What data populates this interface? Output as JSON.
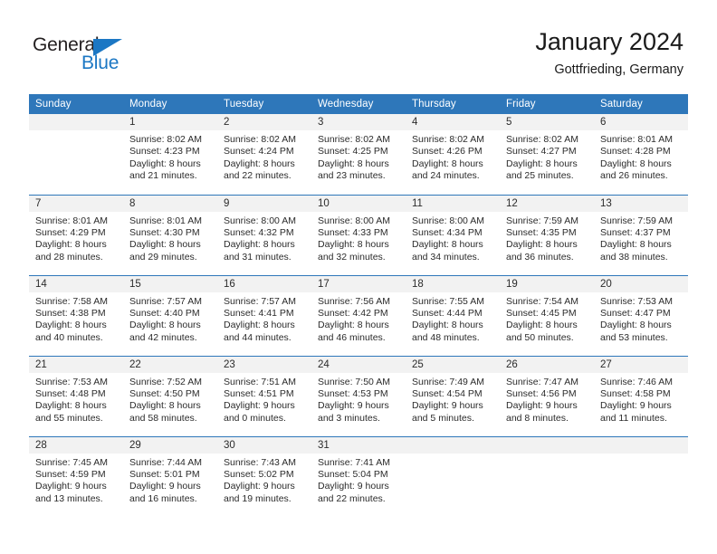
{
  "brand": {
    "name_top": "General",
    "name_bottom": "Blue",
    "accent_color": "#1b77c4"
  },
  "header": {
    "title": "January 2024",
    "location": "Gottfrieding, Germany",
    "header_bg_color": "#2e77ba",
    "daynum_bg_color": "#f2f2f2"
  },
  "weekday_headers": [
    "Sunday",
    "Monday",
    "Tuesday",
    "Wednesday",
    "Thursday",
    "Friday",
    "Saturday"
  ],
  "labels": {
    "sunrise": "Sunrise:",
    "sunset": "Sunset:",
    "daylight": "Daylight:"
  },
  "weeks": [
    [
      {
        "day": "",
        "blank": true
      },
      {
        "day": "1",
        "sunrise": "Sunrise: 8:02 AM",
        "sunset": "Sunset: 4:23 PM",
        "daylight1": "Daylight: 8 hours",
        "daylight2": "and 21 minutes."
      },
      {
        "day": "2",
        "sunrise": "Sunrise: 8:02 AM",
        "sunset": "Sunset: 4:24 PM",
        "daylight1": "Daylight: 8 hours",
        "daylight2": "and 22 minutes."
      },
      {
        "day": "3",
        "sunrise": "Sunrise: 8:02 AM",
        "sunset": "Sunset: 4:25 PM",
        "daylight1": "Daylight: 8 hours",
        "daylight2": "and 23 minutes."
      },
      {
        "day": "4",
        "sunrise": "Sunrise: 8:02 AM",
        "sunset": "Sunset: 4:26 PM",
        "daylight1": "Daylight: 8 hours",
        "daylight2": "and 24 minutes."
      },
      {
        "day": "5",
        "sunrise": "Sunrise: 8:02 AM",
        "sunset": "Sunset: 4:27 PM",
        "daylight1": "Daylight: 8 hours",
        "daylight2": "and 25 minutes."
      },
      {
        "day": "6",
        "sunrise": "Sunrise: 8:01 AM",
        "sunset": "Sunset: 4:28 PM",
        "daylight1": "Daylight: 8 hours",
        "daylight2": "and 26 minutes."
      }
    ],
    [
      {
        "day": "7",
        "sunrise": "Sunrise: 8:01 AM",
        "sunset": "Sunset: 4:29 PM",
        "daylight1": "Daylight: 8 hours",
        "daylight2": "and 28 minutes."
      },
      {
        "day": "8",
        "sunrise": "Sunrise: 8:01 AM",
        "sunset": "Sunset: 4:30 PM",
        "daylight1": "Daylight: 8 hours",
        "daylight2": "and 29 minutes."
      },
      {
        "day": "9",
        "sunrise": "Sunrise: 8:00 AM",
        "sunset": "Sunset: 4:32 PM",
        "daylight1": "Daylight: 8 hours",
        "daylight2": "and 31 minutes."
      },
      {
        "day": "10",
        "sunrise": "Sunrise: 8:00 AM",
        "sunset": "Sunset: 4:33 PM",
        "daylight1": "Daylight: 8 hours",
        "daylight2": "and 32 minutes."
      },
      {
        "day": "11",
        "sunrise": "Sunrise: 8:00 AM",
        "sunset": "Sunset: 4:34 PM",
        "daylight1": "Daylight: 8 hours",
        "daylight2": "and 34 minutes."
      },
      {
        "day": "12",
        "sunrise": "Sunrise: 7:59 AM",
        "sunset": "Sunset: 4:35 PM",
        "daylight1": "Daylight: 8 hours",
        "daylight2": "and 36 minutes."
      },
      {
        "day": "13",
        "sunrise": "Sunrise: 7:59 AM",
        "sunset": "Sunset: 4:37 PM",
        "daylight1": "Daylight: 8 hours",
        "daylight2": "and 38 minutes."
      }
    ],
    [
      {
        "day": "14",
        "sunrise": "Sunrise: 7:58 AM",
        "sunset": "Sunset: 4:38 PM",
        "daylight1": "Daylight: 8 hours",
        "daylight2": "and 40 minutes."
      },
      {
        "day": "15",
        "sunrise": "Sunrise: 7:57 AM",
        "sunset": "Sunset: 4:40 PM",
        "daylight1": "Daylight: 8 hours",
        "daylight2": "and 42 minutes."
      },
      {
        "day": "16",
        "sunrise": "Sunrise: 7:57 AM",
        "sunset": "Sunset: 4:41 PM",
        "daylight1": "Daylight: 8 hours",
        "daylight2": "and 44 minutes."
      },
      {
        "day": "17",
        "sunrise": "Sunrise: 7:56 AM",
        "sunset": "Sunset: 4:42 PM",
        "daylight1": "Daylight: 8 hours",
        "daylight2": "and 46 minutes."
      },
      {
        "day": "18",
        "sunrise": "Sunrise: 7:55 AM",
        "sunset": "Sunset: 4:44 PM",
        "daylight1": "Daylight: 8 hours",
        "daylight2": "and 48 minutes."
      },
      {
        "day": "19",
        "sunrise": "Sunrise: 7:54 AM",
        "sunset": "Sunset: 4:45 PM",
        "daylight1": "Daylight: 8 hours",
        "daylight2": "and 50 minutes."
      },
      {
        "day": "20",
        "sunrise": "Sunrise: 7:53 AM",
        "sunset": "Sunset: 4:47 PM",
        "daylight1": "Daylight: 8 hours",
        "daylight2": "and 53 minutes."
      }
    ],
    [
      {
        "day": "21",
        "sunrise": "Sunrise: 7:53 AM",
        "sunset": "Sunset: 4:48 PM",
        "daylight1": "Daylight: 8 hours",
        "daylight2": "and 55 minutes."
      },
      {
        "day": "22",
        "sunrise": "Sunrise: 7:52 AM",
        "sunset": "Sunset: 4:50 PM",
        "daylight1": "Daylight: 8 hours",
        "daylight2": "and 58 minutes."
      },
      {
        "day": "23",
        "sunrise": "Sunrise: 7:51 AM",
        "sunset": "Sunset: 4:51 PM",
        "daylight1": "Daylight: 9 hours",
        "daylight2": "and 0 minutes."
      },
      {
        "day": "24",
        "sunrise": "Sunrise: 7:50 AM",
        "sunset": "Sunset: 4:53 PM",
        "daylight1": "Daylight: 9 hours",
        "daylight2": "and 3 minutes."
      },
      {
        "day": "25",
        "sunrise": "Sunrise: 7:49 AM",
        "sunset": "Sunset: 4:54 PM",
        "daylight1": "Daylight: 9 hours",
        "daylight2": "and 5 minutes."
      },
      {
        "day": "26",
        "sunrise": "Sunrise: 7:47 AM",
        "sunset": "Sunset: 4:56 PM",
        "daylight1": "Daylight: 9 hours",
        "daylight2": "and 8 minutes."
      },
      {
        "day": "27",
        "sunrise": "Sunrise: 7:46 AM",
        "sunset": "Sunset: 4:58 PM",
        "daylight1": "Daylight: 9 hours",
        "daylight2": "and 11 minutes."
      }
    ],
    [
      {
        "day": "28",
        "sunrise": "Sunrise: 7:45 AM",
        "sunset": "Sunset: 4:59 PM",
        "daylight1": "Daylight: 9 hours",
        "daylight2": "and 13 minutes."
      },
      {
        "day": "29",
        "sunrise": "Sunrise: 7:44 AM",
        "sunset": "Sunset: 5:01 PM",
        "daylight1": "Daylight: 9 hours",
        "daylight2": "and 16 minutes."
      },
      {
        "day": "30",
        "sunrise": "Sunrise: 7:43 AM",
        "sunset": "Sunset: 5:02 PM",
        "daylight1": "Daylight: 9 hours",
        "daylight2": "and 19 minutes."
      },
      {
        "day": "31",
        "sunrise": "Sunrise: 7:41 AM",
        "sunset": "Sunset: 5:04 PM",
        "daylight1": "Daylight: 9 hours",
        "daylight2": "and 22 minutes."
      },
      {
        "day": "",
        "blank": true
      },
      {
        "day": "",
        "blank": true
      },
      {
        "day": "",
        "blank": true
      }
    ]
  ]
}
